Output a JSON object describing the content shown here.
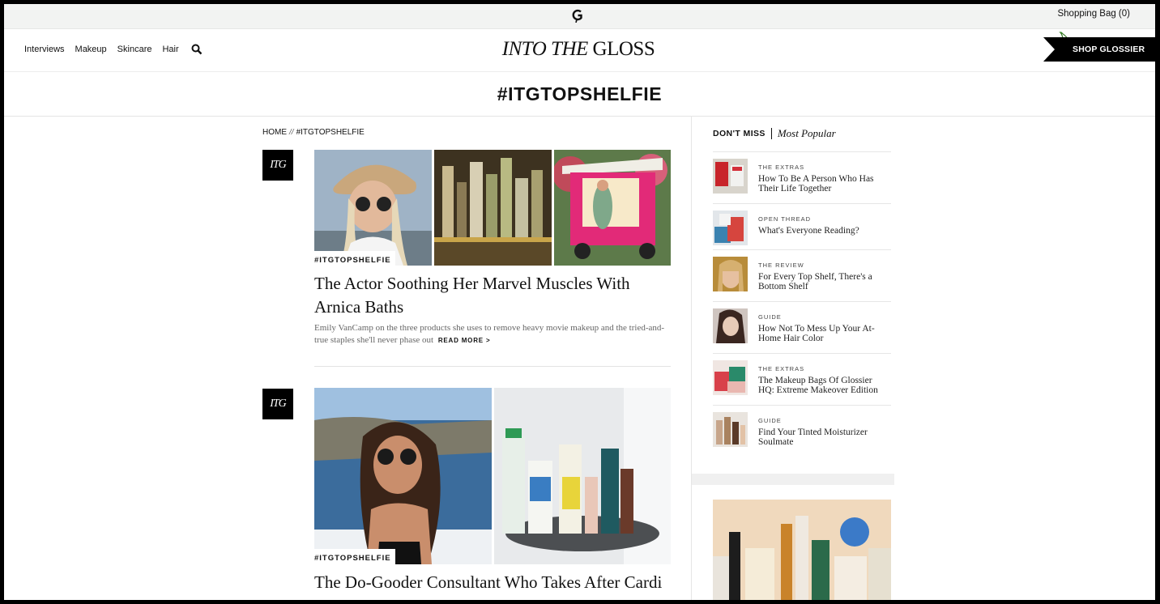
{
  "topbar": {
    "logo_letter": "G",
    "shopping_bag": "Shopping Bag (0)"
  },
  "nav": {
    "links": [
      "Interviews",
      "Makeup",
      "Skincare",
      "Hair"
    ],
    "brand_italic": "INTO THE",
    "brand_rest": "GLOSS",
    "shop_button": "SHOP GLOSSIER"
  },
  "page": {
    "heading": "#ITGTOPSHELFIE"
  },
  "breadcrumb": {
    "home": "HOME",
    "sep": "//",
    "current": "#ITGTOPSHELFIE"
  },
  "articles": [
    {
      "badge": "ITG",
      "tag": "#ITGTOPSHELFIE",
      "title_line1": "The Actor Soothing Her Marvel Muscles With",
      "title_line2": "Arnica Baths",
      "excerpt": "Emily VanCamp on the three products she uses to remove heavy movie makeup and the tried-and-true staples she'll never phase out",
      "read_more": "READ MORE >"
    },
    {
      "badge": "ITG",
      "tag": "#ITGTOPSHELFIE",
      "title_line1": "The Do-Gooder Consultant Who Takes After Cardi"
    }
  ],
  "sidebar": {
    "dont_miss": "DON'T MISS",
    "most_popular": "Most Popular",
    "items": [
      {
        "category": "THE EXTRAS",
        "title": "How To Be A Person Who Has Their Life Together"
      },
      {
        "category": "OPEN THREAD",
        "title": "What's Everyone Reading?"
      },
      {
        "category": "THE REVIEW",
        "title": "For Every Top Shelf, There's a Bottom Shelf"
      },
      {
        "category": "GUIDE",
        "title": "How Not To Mess Up Your At-Home Hair Color"
      },
      {
        "category": "THE EXTRAS",
        "title": "The Makeup Bags Of Glossier HQ: Extreme Makeover Edition"
      },
      {
        "category": "GUIDE",
        "title": "Find Your Tinted Moisturizer Soulmate"
      }
    ]
  }
}
